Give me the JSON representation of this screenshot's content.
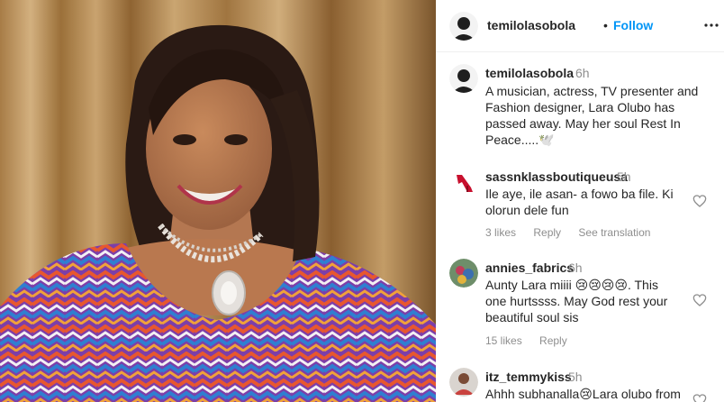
{
  "post": {
    "photo_subject": "woman-smiling-portrait",
    "header": {
      "username": "temilolasobola",
      "separator": "•",
      "follow_label": "Follow",
      "more_icon": "more-horizontal-icon"
    },
    "caption": {
      "username": "temilolasobola",
      "time": "6h",
      "text": "A musician, actress, TV presenter and Fashion designer, Lara Olubo has passed away. May her soul Rest In Peace.....🕊️"
    },
    "comments": [
      {
        "username": "sassnklassboutiqueusa",
        "time": "5h",
        "text": "Ile aye, ile asan- a fowo ba file. Ki olorun dele fun",
        "likes": "3 likes",
        "reply_label": "Reply",
        "translate_label": "See translation"
      },
      {
        "username": "annies_fabrics",
        "time": "6h",
        "text": "Aunty Lara miiii 😢😢😢😢. This one hurtssss. May God rest your beautiful soul sis",
        "likes": "15 likes",
        "reply_label": "Reply"
      },
      {
        "username": "itz_temmykiss",
        "time": "5h",
        "text": "Ahhh subhanalla😢Lara olubo from"
      }
    ]
  },
  "colors": {
    "follow": "#0095f6",
    "text": "#262626",
    "muted": "#8e8e8e",
    "divider": "#dbdbdb"
  }
}
